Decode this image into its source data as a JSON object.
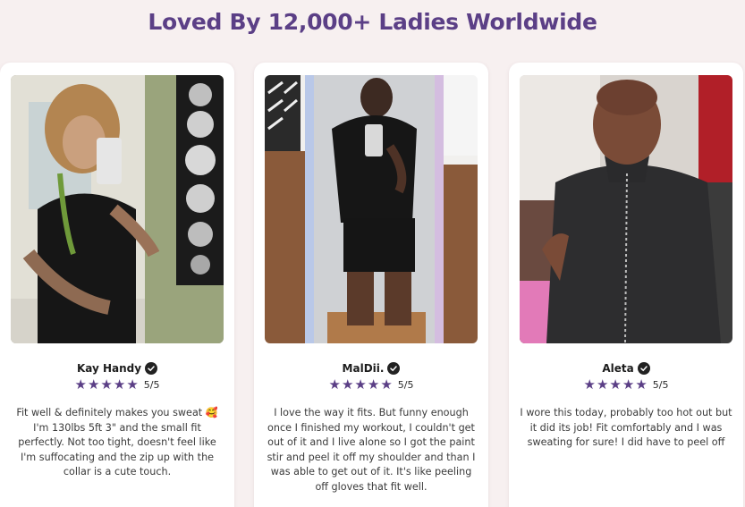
{
  "section": {
    "heading": "Loved By 12,000+ Ladies Worldwide"
  },
  "colors": {
    "accent": "#5b3f86",
    "background": "#f7f0f0",
    "card": "#ffffff"
  },
  "reviews": [
    {
      "name": "Kay Handy",
      "rating": 5,
      "score_text": "5/5",
      "text": "Fit well & definitely makes you sweat 🥰 I'm 130lbs 5ft 3\" and the small fit perfectly. Not too tight, doesn't feel like I'm suffocating and the zip up with the collar is a cute touch."
    },
    {
      "name": "MalDii.",
      "rating": 5,
      "score_text": "5/5",
      "text": "I love the way it fits. But funny enough once I finished my workout, I couldn't get out of it and I live alone so I got the paint stir and peel it off my shoulder and than I was able to get out of it. It's like peeling off gloves that fit well."
    },
    {
      "name": "Aleta",
      "rating": 5,
      "score_text": "5/5",
      "text": "I wore this today, probably too hot out but it did its job! Fit comfortably and I was sweating for sure! I did have to peel off"
    }
  ]
}
